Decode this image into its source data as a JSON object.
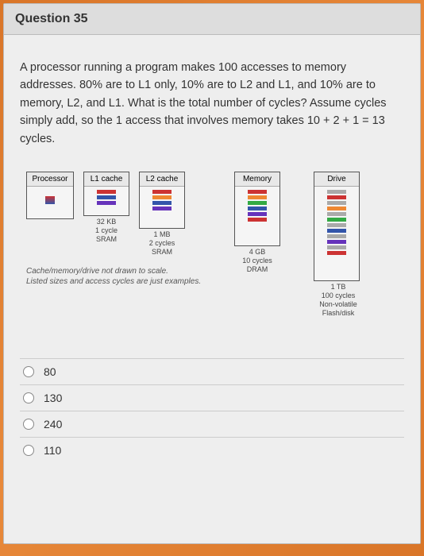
{
  "question": {
    "number_label": "Question 35",
    "text": "A processor running a program makes 100 accesses to memory addresses. 80% are to L1 only, 10% are to L2 and L1, and 10% are to memory, L2, and L1. What is the total number of cycles? Assume cycles simply add, so the 1 access that involves memory takes 10 + 2 + 1 = 13 cycles."
  },
  "diagram": {
    "processor": {
      "title": "Processor"
    },
    "l1": {
      "title": "L1 cache",
      "size": "32 KB",
      "cycles": "1 cycle",
      "type": "SRAM"
    },
    "l2": {
      "title": "L2 cache",
      "size": "1 MB",
      "cycles": "2 cycles",
      "type": "SRAM"
    },
    "memory": {
      "title": "Memory",
      "size": "4 GB",
      "cycles": "10 cycles",
      "type": "DRAM"
    },
    "drive": {
      "title": "Drive",
      "size": "1 TB",
      "cycles": "100 cycles",
      "type": "Non-volatile Flash/disk"
    },
    "caption": "Cache/memory/drive not drawn to scale.\nListed sizes and access cycles are just examples."
  },
  "options": {
    "a": "80",
    "b": "130",
    "c": "240",
    "d": "110"
  }
}
